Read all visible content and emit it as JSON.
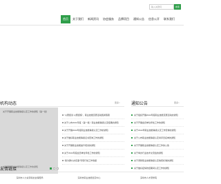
{
  "header": {
    "search_placeholder": "输入关键词",
    "search_button": "搜索",
    "nav": [
      {
        "label": "首页",
        "active": true
      },
      {
        "label": "关于我们",
        "active": false
      },
      {
        "label": "新闻资讯",
        "active": false
      },
      {
        "label": "协会服务",
        "active": false
      },
      {
        "label": "品牌项目",
        "active": false
      },
      {
        "label": "通知公告",
        "active": false
      },
      {
        "label": "信息公开",
        "active": false
      },
      {
        "label": "联系我们",
        "active": false
      }
    ]
  },
  "news": {
    "title": "机构动态",
    "more": "更多>",
    "photo_caption": "关于开展职业技能等级认定工作的通知（第一批）",
    "photo_caption2": "关于开展职业技能等级认定工作的通知",
    "slides": [
      "1",
      "2",
      "3"
    ],
    "items": [
      "“以赛促训 以赛促练”，职业技能竞赛活动圆满落幕",
      "关于公布2021年度（第一批）职业技能等级认定结果的通知",
      "关于开展2022年度职业技能等级认定工作的通知",
      "关于做好职业技能等级证书查询工作的通知",
      "关于开展职业技能提升培训的通知",
      "关于2022年度会员单位年检工作的通知",
      "“我为群众办实事”专项行动工作简报"
    ]
  },
  "notices": {
    "title": "通知公告",
    "more": "更多>",
    "items": [
      "关于组织开展2022年度职业技能竞赛活动的通知",
      "关于开展会员单位年检工作的通知",
      "关于2022年职业技能等级认定工作安排的通知",
      "关于公布职业技能等级认定考评员名单的通知",
      "关于开展职业技能等级认定工作的公告",
      "关于举办行业技术交流会的通知",
      "关于调整职业技能等级认定收费标准的通知",
      "关于做好疫情防控期间认定工作的通知"
    ]
  },
  "links": {
    "title": "友情链接",
    "items": [
      "深圳市人力资源和社会保障局",
      "深圳市职业技能鉴定中心",
      "深圳市人才研修院"
    ]
  },
  "colors": {
    "accent": "#2f9e4a"
  }
}
